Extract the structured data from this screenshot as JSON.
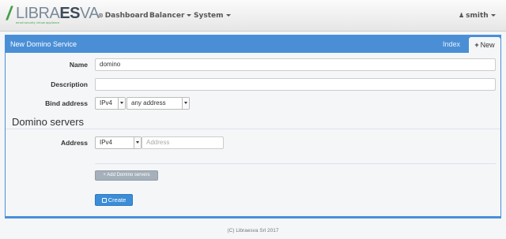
{
  "brand": {
    "slash": "/",
    "name_light": "LIBRA",
    "name_bold": "ES",
    "name_tail": "VA",
    "tagline": "email security virtual appliance"
  },
  "nav": {
    "dashboard": "Dashboard",
    "dashboard_icon": "dashboard-icon",
    "balancer": "Balancer",
    "system": "System",
    "user": "smith",
    "user_icon": "user-icon"
  },
  "panel": {
    "title": "New Domino Service",
    "tab_index": "Index",
    "tab_new": "New",
    "tab_new_icon": "plus-icon"
  },
  "form": {
    "name_label": "Name",
    "name_value": "domino",
    "description_label": "Description",
    "description_value": "",
    "bind_label": "Bind address",
    "bind_ip_version": "IPv4",
    "bind_address": "any address",
    "servers_title": "Domino servers",
    "address_label": "Address",
    "server_ip_version": "IPv4",
    "server_address_placeholder": "Address",
    "add_button": "+ Add Domino servers",
    "create_button": "Create",
    "create_icon": "save-icon"
  },
  "footer": {
    "text": "(C) Libraesva Srl 2017"
  },
  "colors": {
    "accent": "#4a8fd6",
    "brand_green": "#43a047",
    "create_button": "#3c8dd8",
    "add_button": "#a6b0bb"
  }
}
